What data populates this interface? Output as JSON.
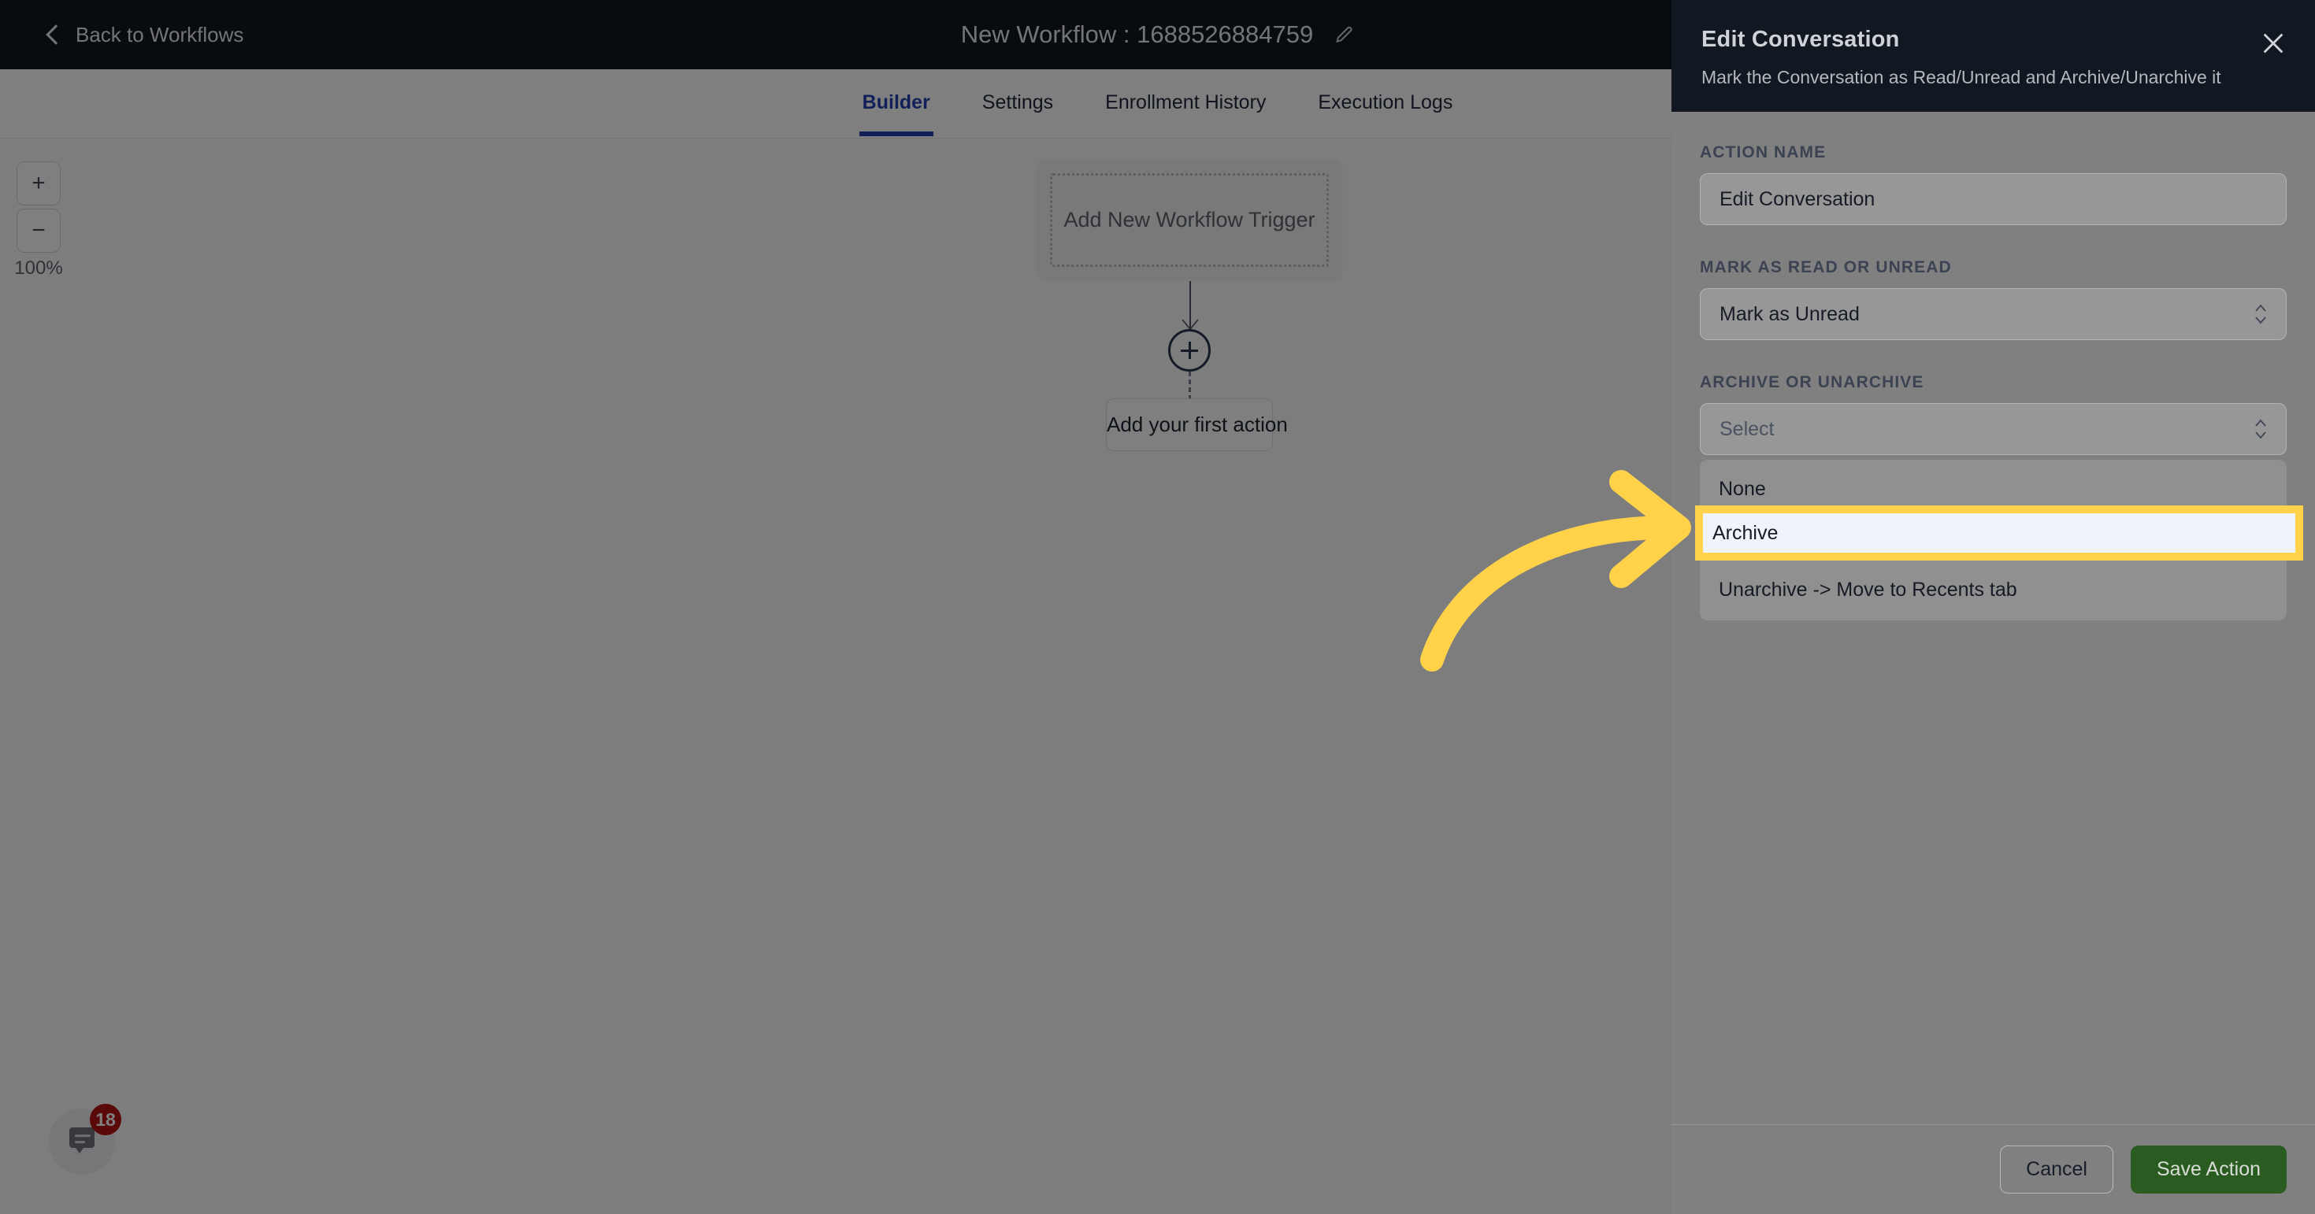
{
  "topbar": {
    "back_label": "Back to Workflows",
    "back_icon": "chevron-left-icon",
    "workflow_title": "New Workflow : 1688526884759",
    "edit_icon": "pencil-icon"
  },
  "tabs": [
    {
      "label": "Builder",
      "active": true
    },
    {
      "label": "Settings",
      "active": false
    },
    {
      "label": "Enrollment History",
      "active": false
    },
    {
      "label": "Execution Logs",
      "active": false
    }
  ],
  "canvas": {
    "zoom": {
      "in_label": "+",
      "out_label": "−",
      "level": "100%"
    },
    "trigger_node_label": "Add New Workflow Trigger",
    "plus_icon": "plus-circle-icon",
    "action_node_label": "Add your first action",
    "chat": {
      "icon": "chat-bubble-icon",
      "badge": "18"
    }
  },
  "panel": {
    "title": "Edit Conversation",
    "subtitle": "Mark the Conversation as Read/Unread and Archive/Unarchive it",
    "close_icon": "close-icon",
    "fields": [
      {
        "label": "ACTION NAME",
        "type": "text",
        "value": "Edit Conversation"
      },
      {
        "label": "MARK AS READ OR UNREAD",
        "type": "select",
        "value": "Mark as Unread",
        "stepper_icon": "chevron-updown-icon"
      },
      {
        "label": "ARCHIVE OR UNARCHIVE",
        "type": "select",
        "value": "Select",
        "is_placeholder": true,
        "stepper_icon": "chevron-updown-icon"
      }
    ],
    "dropdown_options": [
      {
        "label": "None",
        "highlighted": false
      },
      {
        "label": "Archive",
        "highlighted": true
      },
      {
        "label": "Unarchive -> Move to Recents tab",
        "highlighted": false
      }
    ],
    "footer": {
      "cancel_label": "Cancel",
      "save_label": "Save Action"
    }
  },
  "annotation": {
    "arrow_icon": "curved-arrow-right-icon",
    "arrow_color": "#FFD24A",
    "highlight_color": "#FFD24A",
    "highlight_target": "Archive"
  },
  "colors": {
    "topbar_bg": "#111821",
    "accent_blue": "#2440B3",
    "save_green": "#2A5C22",
    "badge_red": "#B3120F",
    "highlight_yellow": "#FFD24A",
    "highlight_fill": "#EFF4FB",
    "dim_overlay": "rgba(0,0,0,0.5)"
  }
}
